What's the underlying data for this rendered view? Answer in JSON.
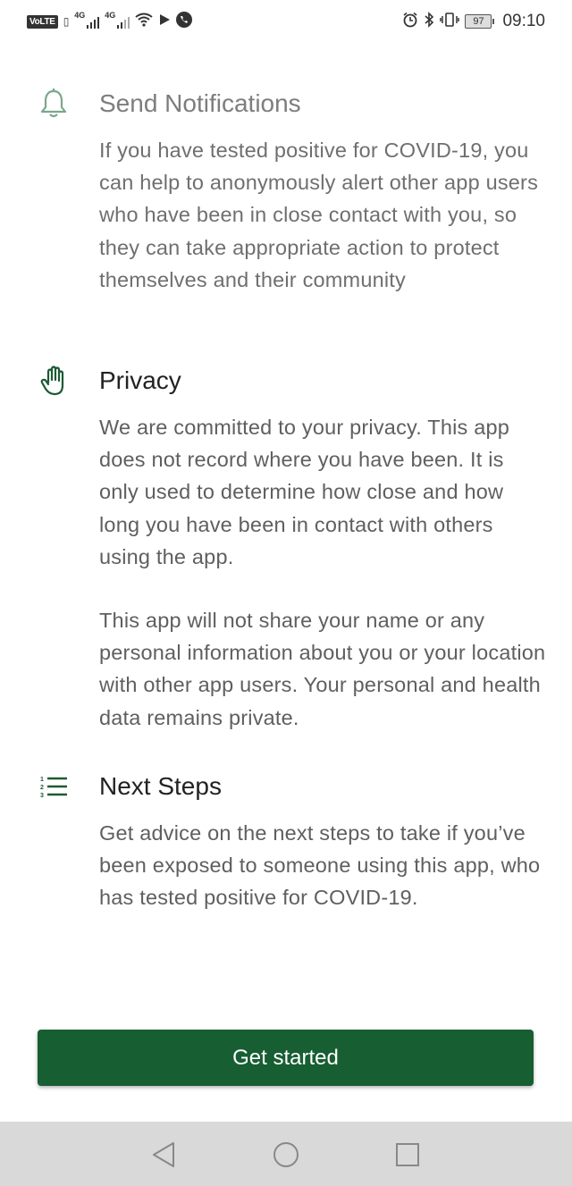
{
  "status_bar": {
    "volte": "VoLTE",
    "net1": "4G",
    "net2": "4G",
    "battery": "97",
    "time": "09:10"
  },
  "sections": {
    "notifications": {
      "title": "Send Notifications",
      "body": "If you have tested positive for COVID-19, you can help to anonymously alert other app users who have been in close contact with you, so they can take appropriate action to protect themselves and their community",
      "icon": "bell-icon"
    },
    "privacy": {
      "title": "Privacy",
      "body1": "We are committed to your privacy. This app does not record where you have been. It is only used to determine how close and how long you have been in contact with others using the app.",
      "body2": "This app will not share your name or any personal information about you or your location with other app users. Your personal and health data remains private.",
      "icon": "hand-icon"
    },
    "next_steps": {
      "title": "Next Steps",
      "body": "Get advice on the next steps to take if you’ve been exposed to someone using this app, who has tested positive for COVID-19.",
      "icon": "numbered-list-icon"
    }
  },
  "cta": {
    "label": "Get started"
  },
  "colors": {
    "accent": "#175e33",
    "icon_faded": "#7aa88a"
  }
}
